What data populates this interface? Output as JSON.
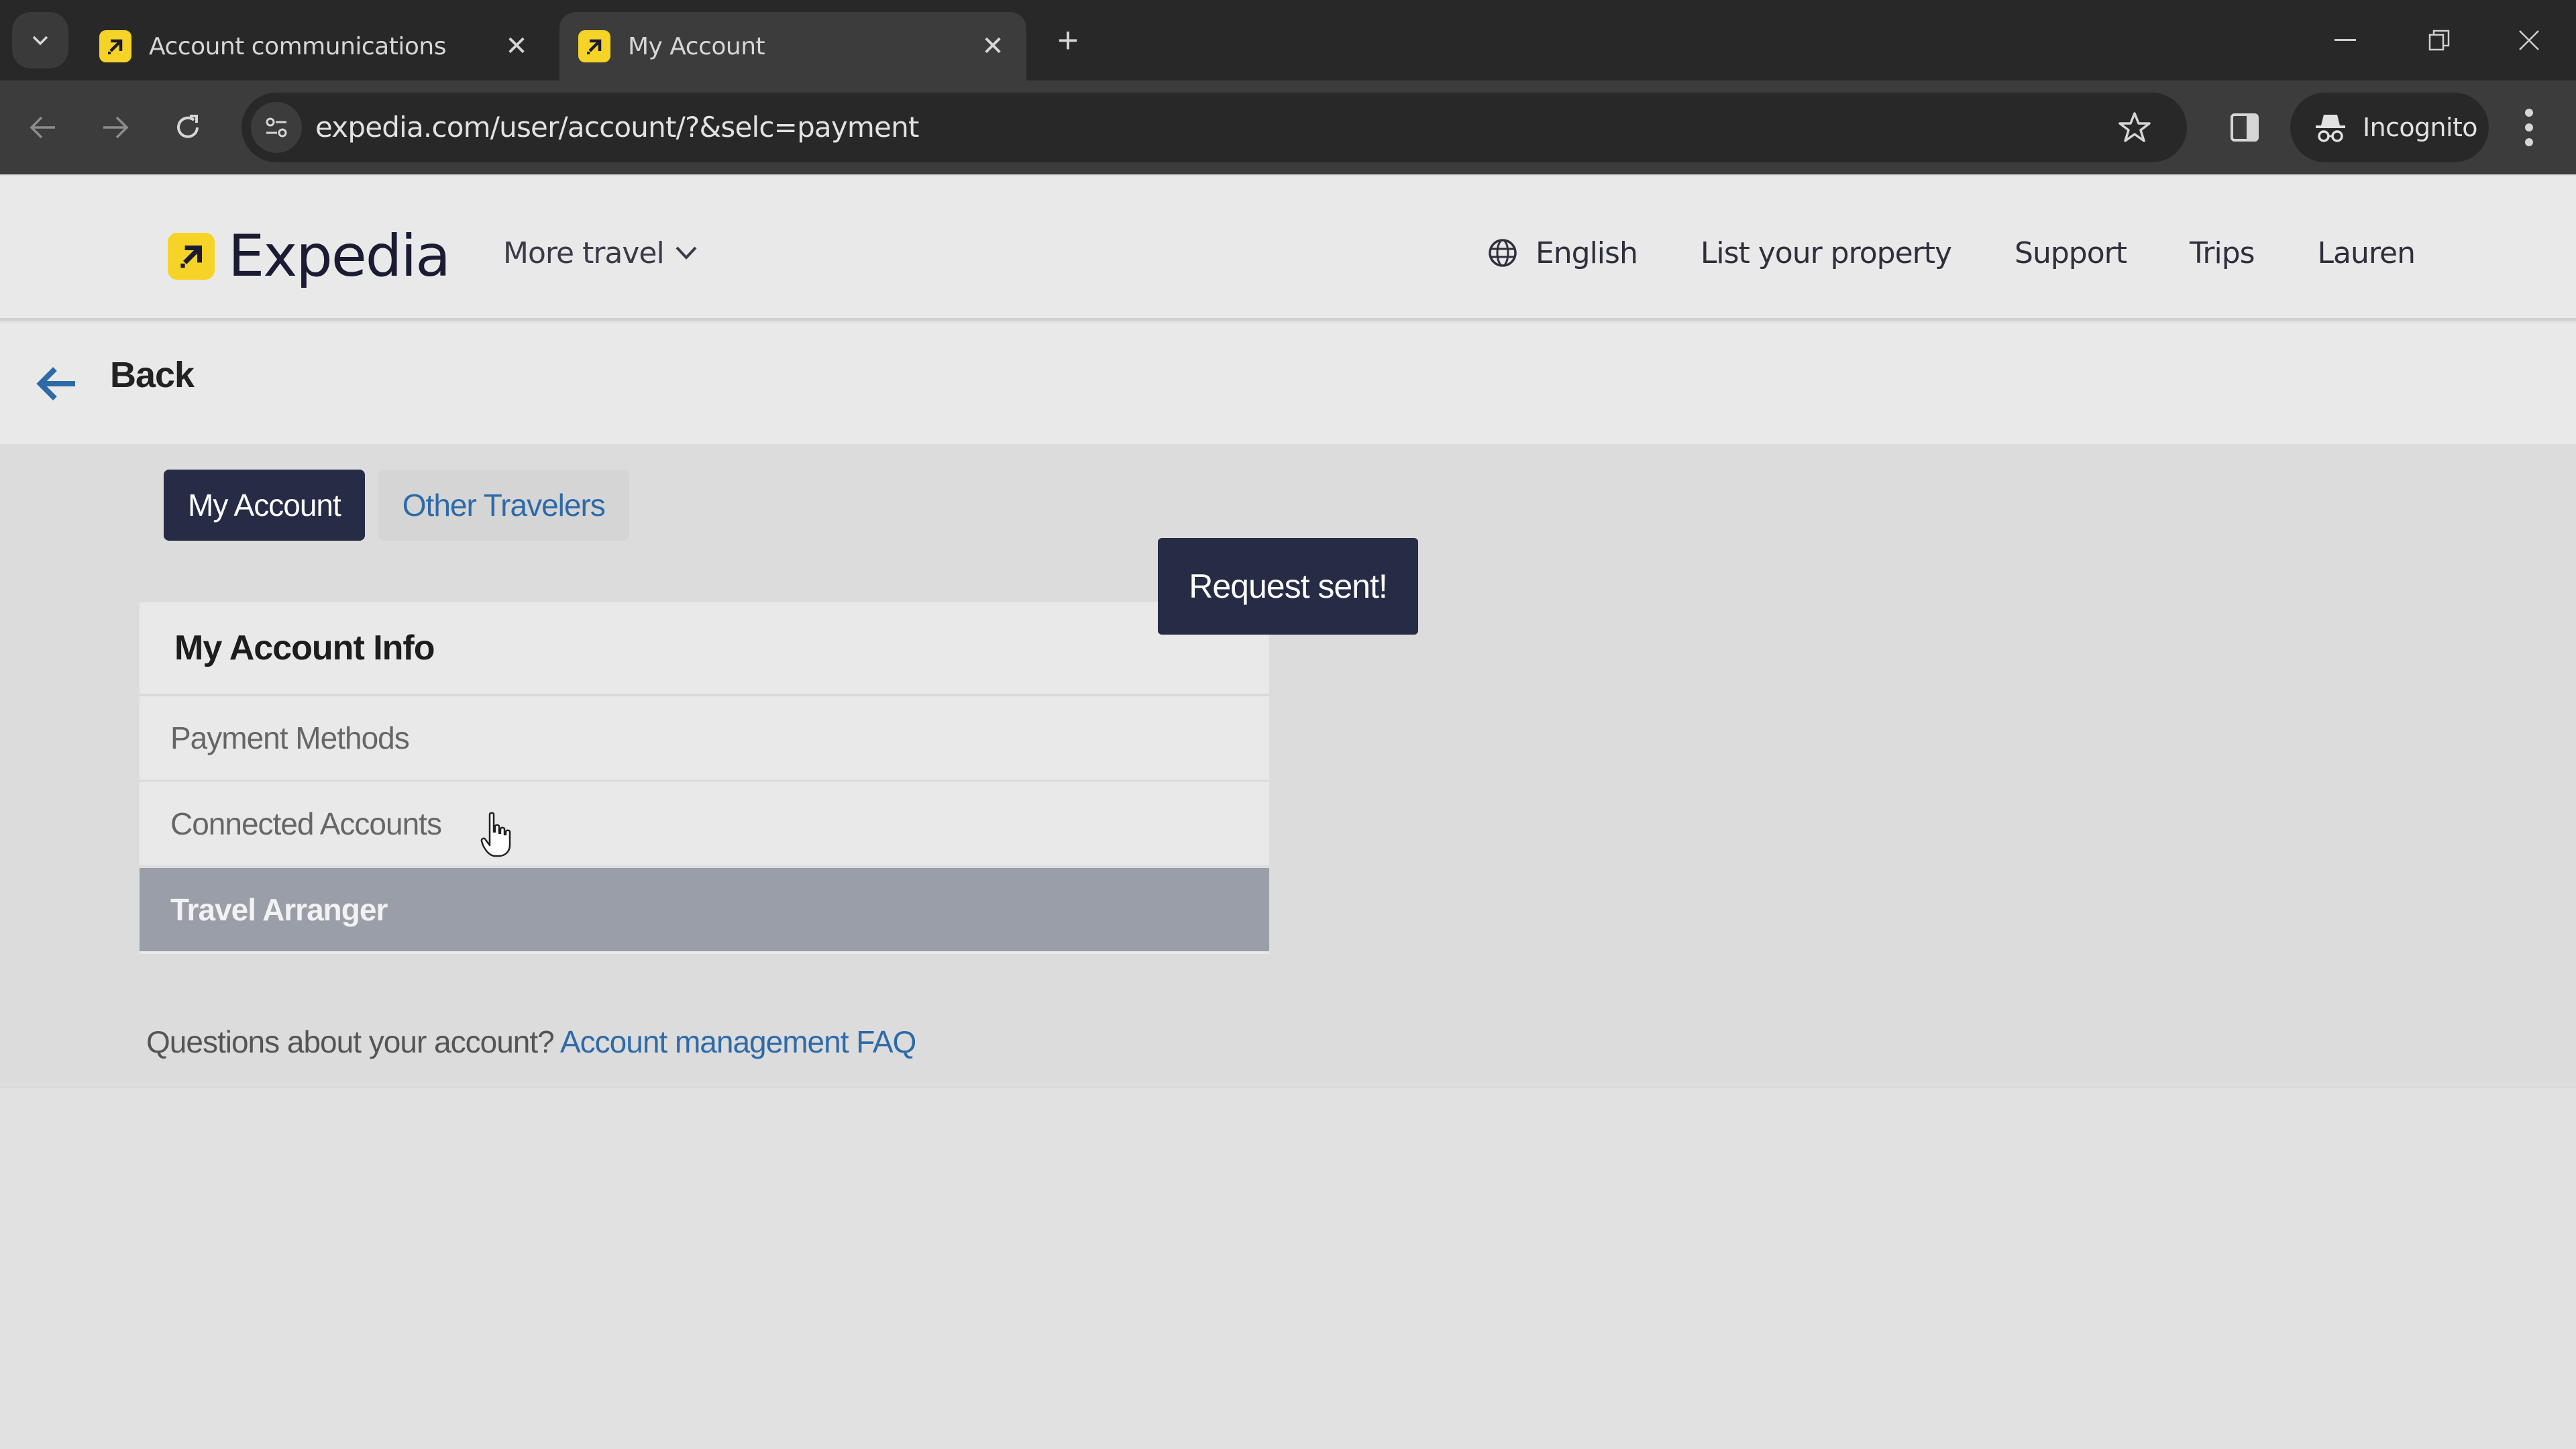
{
  "browser": {
    "tabs": [
      {
        "title": "Account communications",
        "active": false
      },
      {
        "title": "My Account",
        "active": true
      }
    ],
    "url": "expedia.com/user/account/?&selc=payment",
    "profile_label": "Incognito",
    "icons": {
      "tab_search": "chevron-down-icon",
      "tab_close": "close-icon",
      "new_tab": "plus-icon",
      "back": "arrow-left-icon",
      "forward": "arrow-right-icon",
      "reload": "reload-icon",
      "site_info": "tune-icon",
      "bookmark": "star-icon",
      "side_panel": "side-panel-icon",
      "incognito": "incognito-icon",
      "menu": "more-vert-icon",
      "minimize": "minimize-icon",
      "restore": "restore-icon",
      "close_window": "close-icon"
    }
  },
  "header": {
    "brand": "Expedia",
    "more_travel": "More travel",
    "language": "English",
    "list_property": "List your property",
    "support": "Support",
    "trips": "Trips",
    "user": "Lauren"
  },
  "back": {
    "label": "Back"
  },
  "tabs": {
    "my_account": "My Account",
    "other_travelers": "Other Travelers"
  },
  "toast": {
    "message": "Request sent!"
  },
  "account_info": {
    "title": "My Account Info",
    "items": [
      {
        "label": "Payment Methods",
        "selected": false
      },
      {
        "label": "Connected Accounts",
        "selected": false
      },
      {
        "label": "Travel Arranger",
        "selected": true
      }
    ]
  },
  "faq": {
    "prompt": "Questions about your account?",
    "link": "Account management FAQ"
  },
  "colors": {
    "brand_yellow": "#f5d327",
    "navy": "#262c45",
    "link_blue": "#2e6aa8",
    "selected_row": "#9a9ea8"
  }
}
